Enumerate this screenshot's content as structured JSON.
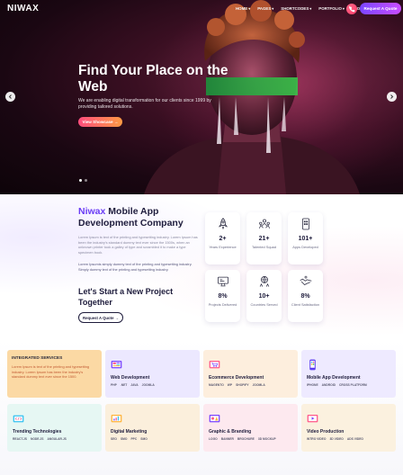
{
  "header": {
    "logo": "NIWAX",
    "menu": [
      "HOME",
      "PAGES",
      "SHORTCODES",
      "PORTFOLIO",
      "BLOG"
    ],
    "quote_button": "Request A Quote"
  },
  "hero": {
    "title": "Find Your Place on the Web",
    "text": "We are enabling digital transformation for our clients since 1999 by providing tailored solutions.",
    "button": "View Showcase",
    "slides": 2,
    "active_slide": 1
  },
  "about": {
    "brand": "Niwax",
    "title_rest": "Mobile App Development Company",
    "paragraph1": "Lorem Ipsum is text of the printing and typesetting industry. Lorem Ipsum has been the industry's standard dummy text ever since the 1500s, when an unknown printer took a galley of type and scrambled it to make a type specimen book.",
    "paragraph2": "Lorem Ipsumis simply dummy text of the printing and typesetting industry. Simply dummy text of the printing and typesetting industry.",
    "start_title": "Let's Start a New Project Together",
    "quote_button": "Request A Quote"
  },
  "stats": [
    {
      "value": "2+",
      "label": "Years Experience",
      "icon": "rocket-icon"
    },
    {
      "value": "21+",
      "label": "Talented Squad",
      "icon": "team-icon"
    },
    {
      "value": "101+",
      "label": "Apps Developed",
      "icon": "app-grid-icon"
    },
    {
      "value": "8%",
      "label": "Projects Delivered",
      "icon": "monitor-icon"
    },
    {
      "value": "10+",
      "label": "Countries Served",
      "icon": "globe-people-icon"
    },
    {
      "value": "8%",
      "label": "Client Satisfaction",
      "icon": "handshake-icon"
    }
  ],
  "services": {
    "intro_title": "INTEGRATED SERVICES",
    "intro_text": "Lorem Ipsum is text of the printing and typesetting industry. Lorem Ipsum has been the industry's standard dummy text ever since the 1500.",
    "items": [
      {
        "name": "Web Development",
        "tags": [
          "PHP",
          ".NET",
          "JAVA",
          "JOOMLA"
        ],
        "icon": "web-dev-icon",
        "bg": "#ece8ff"
      },
      {
        "name": "Ecommerce Development",
        "tags": [
          "MAGENTO",
          "WP",
          "SHOPIFY",
          "JOOMLA"
        ],
        "icon": "ecommerce-icon",
        "bg": "#fdeedd"
      },
      {
        "name": "Mobile App Development",
        "tags": [
          "IPHONE",
          "ANDROID",
          "CROSS PLATFORM"
        ],
        "icon": "mobile-app-icon",
        "bg": "#eeeaff"
      },
      {
        "name": "Trending Technologies",
        "tags": [
          "REACT.JS",
          "NODE.JS",
          "ANGULAR.JS"
        ],
        "icon": "tech-icon",
        "bg": "#e6f7f3"
      },
      {
        "name": "Digital Marketing",
        "tags": [
          "SEO",
          "SMO",
          "PPC",
          "SMO"
        ],
        "icon": "marketing-icon",
        "bg": "#fbefdc"
      },
      {
        "name": "Graphic & Branding",
        "tags": [
          "LOGO",
          "BANNER",
          "BROCHURE",
          "3D MOCKUP"
        ],
        "icon": "graphic-icon",
        "bg": "#fde9ef"
      },
      {
        "name": "Video Production",
        "tags": [
          "INTRO VIDEO",
          "3D VIDEO",
          "ADS VIDEO"
        ],
        "icon": "video-icon",
        "bg": "#fbf1df"
      }
    ]
  },
  "colors": {
    "accent": "#6a3cf5",
    "gradient_start": "#7b46ff",
    "gradient_end": "#c94dff",
    "hero_button_start": "#ff4d7d",
    "hero_button_end": "#ff9a44",
    "intro_card": "#fbd9a4"
  }
}
